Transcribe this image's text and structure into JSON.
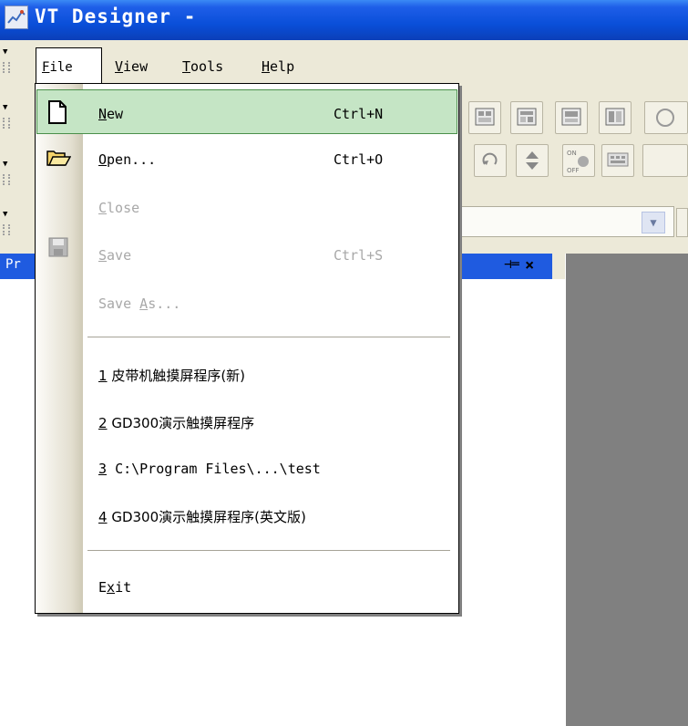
{
  "window": {
    "title": "VT Designer -",
    "app_icon": "app-icon"
  },
  "menubar": {
    "items": [
      {
        "label": "File"
      },
      {
        "label": "View"
      },
      {
        "label": "Tools"
      },
      {
        "label": "Help"
      }
    ]
  },
  "panel": {
    "title": "Pr",
    "pin_icon": "pin-icon",
    "close_icon": "close-icon"
  },
  "file_menu": {
    "items": [
      {
        "label": "New",
        "shortcut": "Ctrl+N",
        "icon": "new-document-icon",
        "enabled": true,
        "highlighted": true
      },
      {
        "label": "Open...",
        "shortcut": "Ctrl+O",
        "icon": "open-folder-icon",
        "enabled": true
      },
      {
        "label": "Close",
        "shortcut": "",
        "enabled": false
      },
      {
        "label": "Save",
        "shortcut": "Ctrl+S",
        "icon": "save-disk-icon",
        "enabled": false
      },
      {
        "label": "Save As...",
        "shortcut": "",
        "enabled": false
      }
    ],
    "recent": [
      {
        "num": "1",
        "label": "皮带机触摸屏程序(新)"
      },
      {
        "num": "2",
        "label": "GD300演示触摸屏程序"
      },
      {
        "num": "3",
        "label": "C:\\Program Files\\...\\test"
      },
      {
        "num": "4",
        "label": "GD300演示触摸屏程序(英文版)"
      }
    ],
    "exit_label": "Exit"
  },
  "colors": {
    "titlebar": "#0a4fd9",
    "highlight": "#c5e5c5",
    "highlight_border": "#4a8f4a",
    "panel_header": "#1f5be0",
    "workarea": "#808080"
  }
}
